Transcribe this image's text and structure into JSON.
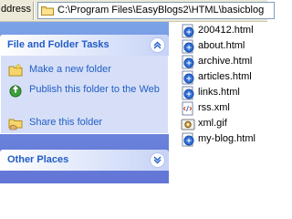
{
  "address_bar": {
    "label": "ddress",
    "path": "C:\\Program Files\\EasyBlogs2\\HTML\\basicblog"
  },
  "task_pane": {
    "file_folder_tasks": {
      "title": "File and Folder Tasks",
      "tasks": [
        {
          "label": "Make a new folder",
          "icon": "new-folder-icon"
        },
        {
          "label": "Publish this folder to the Web",
          "icon": "publish-web-icon"
        },
        {
          "label": "Share this folder",
          "icon": "share-folder-icon"
        }
      ]
    },
    "other_places": {
      "title": "Other Places"
    }
  },
  "files": [
    {
      "name": "200412.html",
      "icon": "html-file-icon"
    },
    {
      "name": "about.html",
      "icon": "html-file-icon"
    },
    {
      "name": "archive.html",
      "icon": "html-file-icon"
    },
    {
      "name": "articles.html",
      "icon": "html-file-icon"
    },
    {
      "name": "links.html",
      "icon": "html-file-icon"
    },
    {
      "name": "rss.xml",
      "icon": "xml-file-icon"
    },
    {
      "name": "xml.gif",
      "icon": "gif-image-icon"
    },
    {
      "name": "my-blog.html",
      "icon": "html-file-icon"
    }
  ],
  "colors": {
    "pane_gradient_top": "#7ba2e7",
    "pane_gradient_bottom": "#6375d6",
    "task_link": "#215dc6",
    "group_body": "#d6dff7",
    "toolbar": "#ece9d8"
  }
}
